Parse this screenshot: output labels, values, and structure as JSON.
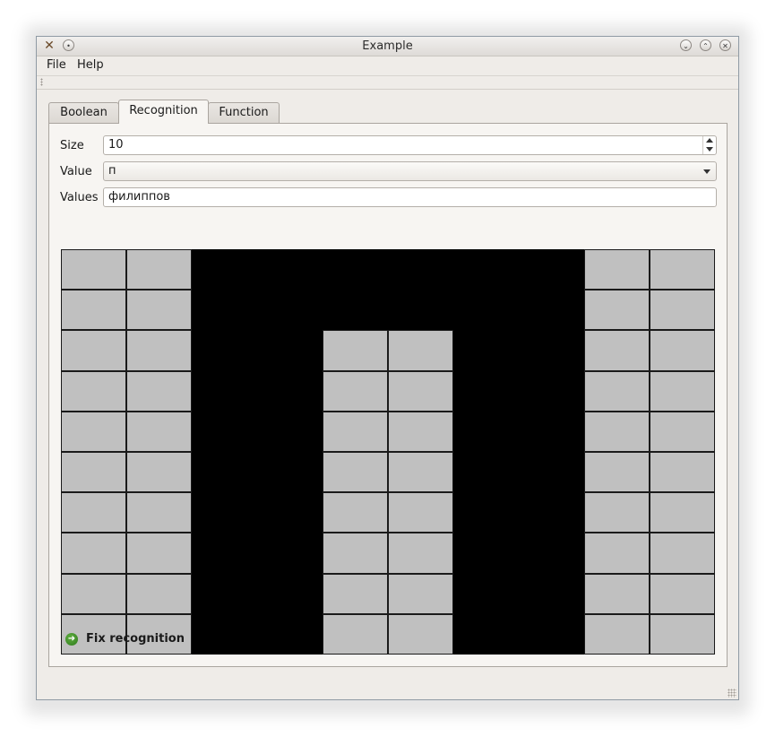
{
  "window": {
    "title": "Example",
    "controls": [
      "minimize-icon",
      "maximize-icon",
      "close-icon"
    ]
  },
  "menu": {
    "file": "File",
    "help": "Help"
  },
  "tabs": [
    {
      "label": "Boolean",
      "active": false
    },
    {
      "label": "Recognition",
      "active": true
    },
    {
      "label": "Function",
      "active": false
    }
  ],
  "form": {
    "size_label": "Size",
    "size_value": "10",
    "value_label": "Value",
    "value_value": "п",
    "values_label": "Values",
    "values_value": "филиппов"
  },
  "grid": {
    "rows": 10,
    "cols": 10,
    "cells": [
      "0011111100",
      "0011111100",
      "0011001100",
      "0011001100",
      "0011001100",
      "0011001100",
      "0011001100",
      "0011001100",
      "0011001100",
      "0011001100"
    ],
    "colors": {
      "on": "#000000",
      "off": "#c0c0c0"
    }
  },
  "fix_button": {
    "label": "Fix recognition",
    "icon": "arrow-right-circle-icon"
  }
}
